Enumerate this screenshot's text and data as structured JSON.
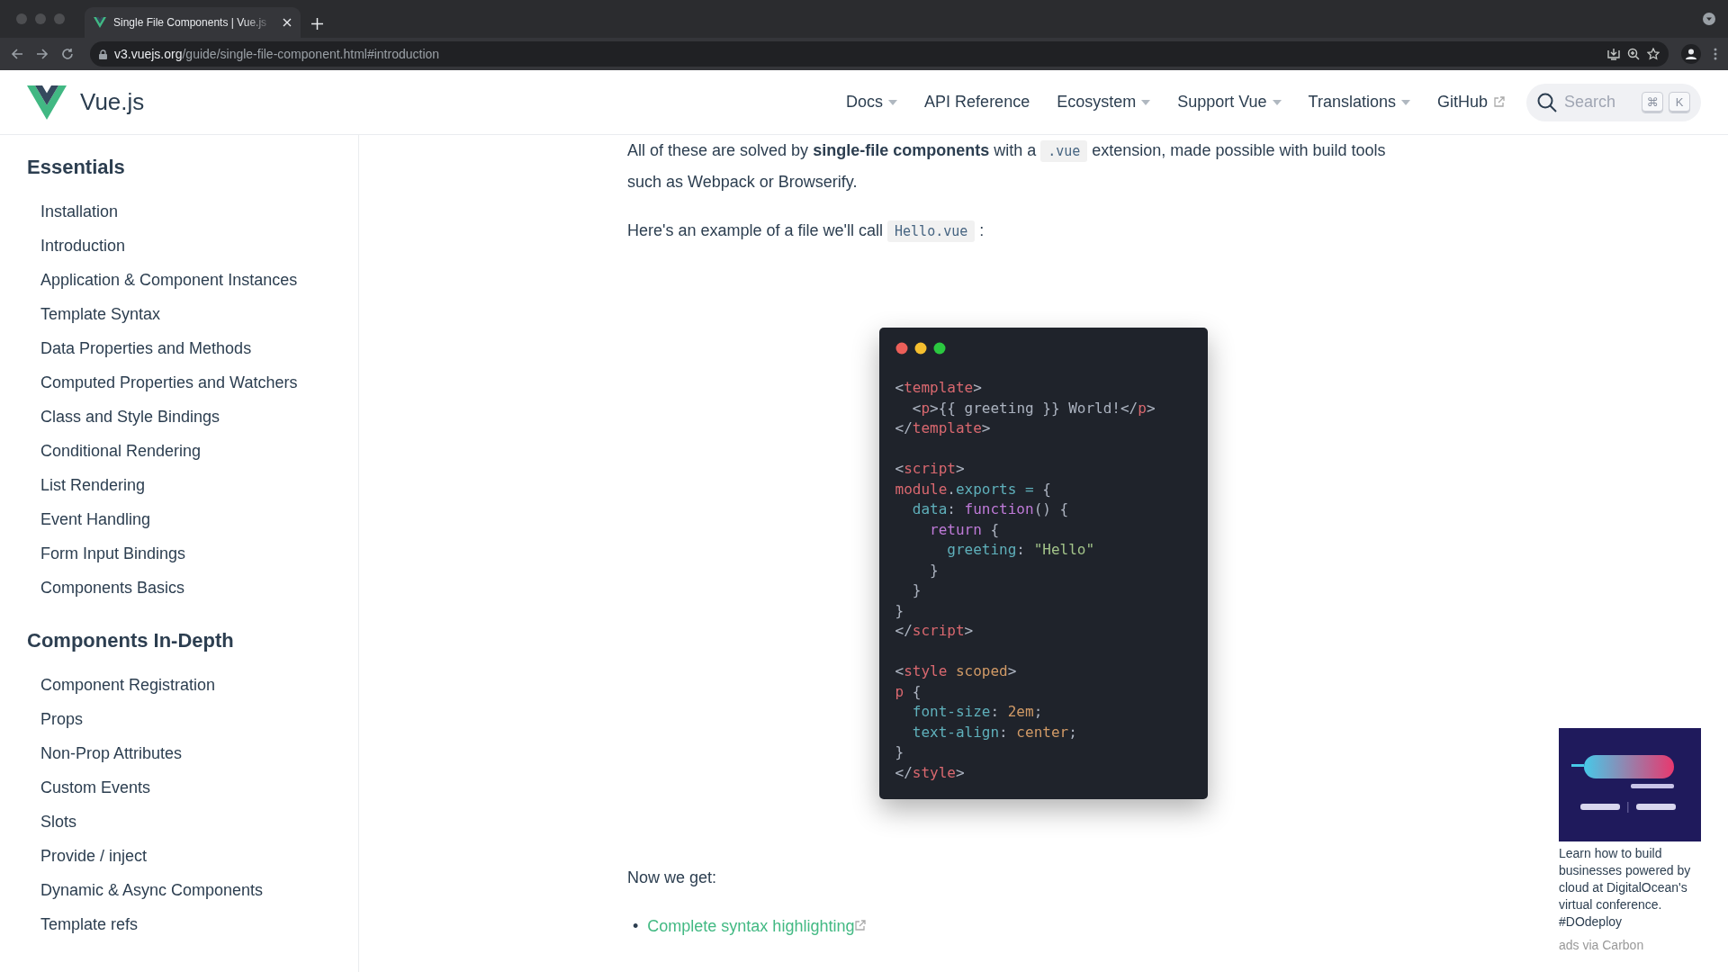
{
  "browser": {
    "tab_title": "Single File Components | Vue.js",
    "url_host": "v3.vuejs.org",
    "url_path": "/guide/single-file-component.html#introduction"
  },
  "header": {
    "logo_text": "Vue.js",
    "nav": [
      {
        "label": "Docs",
        "dropdown": true,
        "external": false
      },
      {
        "label": "API Reference",
        "dropdown": false,
        "external": false
      },
      {
        "label": "Ecosystem",
        "dropdown": true,
        "external": false
      },
      {
        "label": "Support Vue",
        "dropdown": true,
        "external": false
      },
      {
        "label": "Translations",
        "dropdown": true,
        "external": false
      },
      {
        "label": "GitHub",
        "dropdown": false,
        "external": true
      }
    ],
    "search": {
      "placeholder": "Search",
      "keys": [
        "⌘",
        "K"
      ]
    }
  },
  "sidebar": {
    "sections": [
      {
        "title": "Essentials",
        "items": [
          "Installation",
          "Introduction",
          "Application & Component Instances",
          "Template Syntax",
          "Data Properties and Methods",
          "Computed Properties and Watchers",
          "Class and Style Bindings",
          "Conditional Rendering",
          "List Rendering",
          "Event Handling",
          "Form Input Bindings",
          "Components Basics"
        ]
      },
      {
        "title": "Components In-Depth",
        "items": [
          "Component Registration",
          "Props",
          "Non-Prop Attributes",
          "Custom Events",
          "Slots",
          "Provide / inject",
          "Dynamic & Async Components",
          "Template refs"
        ]
      }
    ]
  },
  "content": {
    "paragraphs": [
      [
        {
          "kind": "text",
          "text": "All of these are solved by "
        },
        {
          "kind": "bold",
          "text": "single-file components"
        },
        {
          "kind": "text",
          "text": " with a "
        },
        {
          "kind": "code",
          "text": ".vue"
        },
        {
          "kind": "text",
          "text": " extension, made possible with build tools such as Webpack or Browserify."
        }
      ],
      [
        {
          "kind": "text",
          "text": "Here's an example of a file we'll call "
        },
        {
          "kind": "code",
          "text": "Hello.vue"
        },
        {
          "kind": "text",
          "text": " :"
        }
      ]
    ],
    "code_window": {
      "lines": [
        {
          "kind": "code",
          "segments": [
            {
              "kind": "punct",
              "text": "<"
            },
            {
              "kind": "tag",
              "text": "template"
            },
            {
              "kind": "punct",
              "text": ">"
            }
          ]
        },
        {
          "kind": "code",
          "segments": [
            {
              "kind": "punct",
              "text": "  <"
            },
            {
              "kind": "tag",
              "text": "p"
            },
            {
              "kind": "punct",
              "text": ">{{ greeting }} World!</"
            },
            {
              "kind": "tag",
              "text": "p"
            },
            {
              "kind": "punct",
              "text": ">"
            }
          ]
        },
        {
          "kind": "code",
          "segments": [
            {
              "kind": "punct",
              "text": "</"
            },
            {
              "kind": "tag",
              "text": "template"
            },
            {
              "kind": "punct",
              "text": ">"
            }
          ]
        },
        {
          "kind": "blank"
        },
        {
          "kind": "code",
          "segments": [
            {
              "kind": "punct",
              "text": "<"
            },
            {
              "kind": "tag",
              "text": "script"
            },
            {
              "kind": "punct",
              "text": ">"
            }
          ]
        },
        {
          "kind": "code",
          "segments": [
            {
              "kind": "tag",
              "text": "module"
            },
            {
              "kind": "punct",
              "text": "."
            },
            {
              "kind": "prop",
              "text": "exports ="
            },
            {
              "kind": "punct",
              "text": " {"
            }
          ]
        },
        {
          "kind": "code",
          "segments": [
            {
              "kind": "prop",
              "text": "  data"
            },
            {
              "kind": "punct",
              "text": ": "
            },
            {
              "kind": "keyword",
              "text": "function"
            },
            {
              "kind": "punct",
              "text": "() {"
            }
          ]
        },
        {
          "kind": "code",
          "segments": [
            {
              "kind": "keyword",
              "text": "    return"
            },
            {
              "kind": "punct",
              "text": " {"
            }
          ]
        },
        {
          "kind": "code",
          "segments": [
            {
              "kind": "prop",
              "text": "      greeting"
            },
            {
              "kind": "punct",
              "text": ": "
            },
            {
              "kind": "string",
              "text": "\"Hello\""
            }
          ]
        },
        {
          "kind": "code",
          "segments": [
            {
              "kind": "punct",
              "text": "    }"
            }
          ]
        },
        {
          "kind": "code",
          "segments": [
            {
              "kind": "punct",
              "text": "  }"
            }
          ]
        },
        {
          "kind": "code",
          "segments": [
            {
              "kind": "punct",
              "text": "}"
            }
          ]
        },
        {
          "kind": "code",
          "segments": [
            {
              "kind": "punct",
              "text": "</"
            },
            {
              "kind": "tag",
              "text": "script"
            },
            {
              "kind": "punct",
              "text": ">"
            }
          ]
        },
        {
          "kind": "blank"
        },
        {
          "kind": "code",
          "segments": [
            {
              "kind": "punct",
              "text": "<"
            },
            {
              "kind": "tag",
              "text": "style"
            },
            {
              "kind": "value",
              "text": " scoped"
            },
            {
              "kind": "punct",
              "text": ">"
            }
          ]
        },
        {
          "kind": "code",
          "segments": [
            {
              "kind": "tag",
              "text": "p"
            },
            {
              "kind": "punct",
              "text": " {"
            }
          ]
        },
        {
          "kind": "code",
          "segments": [
            {
              "kind": "prop",
              "text": "  font-size"
            },
            {
              "kind": "punct",
              "text": ": "
            },
            {
              "kind": "value",
              "text": "2em"
            },
            {
              "kind": "punct",
              "text": ";"
            }
          ]
        },
        {
          "kind": "code",
          "segments": [
            {
              "kind": "prop",
              "text": "  text-align"
            },
            {
              "kind": "punct",
              "text": ": "
            },
            {
              "kind": "value",
              "text": "center"
            },
            {
              "kind": "punct",
              "text": ";"
            }
          ]
        },
        {
          "kind": "code",
          "segments": [
            {
              "kind": "punct",
              "text": "}"
            }
          ]
        },
        {
          "kind": "code",
          "segments": [
            {
              "kind": "punct",
              "text": "</"
            },
            {
              "kind": "tag",
              "text": "style"
            },
            {
              "kind": "punct",
              "text": ">"
            }
          ]
        }
      ]
    },
    "after_text": "Now we get:",
    "links": [
      {
        "bullet": "•",
        "label": "Complete syntax highlighting",
        "external": true
      }
    ]
  },
  "ad": {
    "text": "Learn how to build businesses powered by cloud at DigitalOcean's virtual conference. #DOdeploy",
    "credit": "ads via Carbon"
  }
}
